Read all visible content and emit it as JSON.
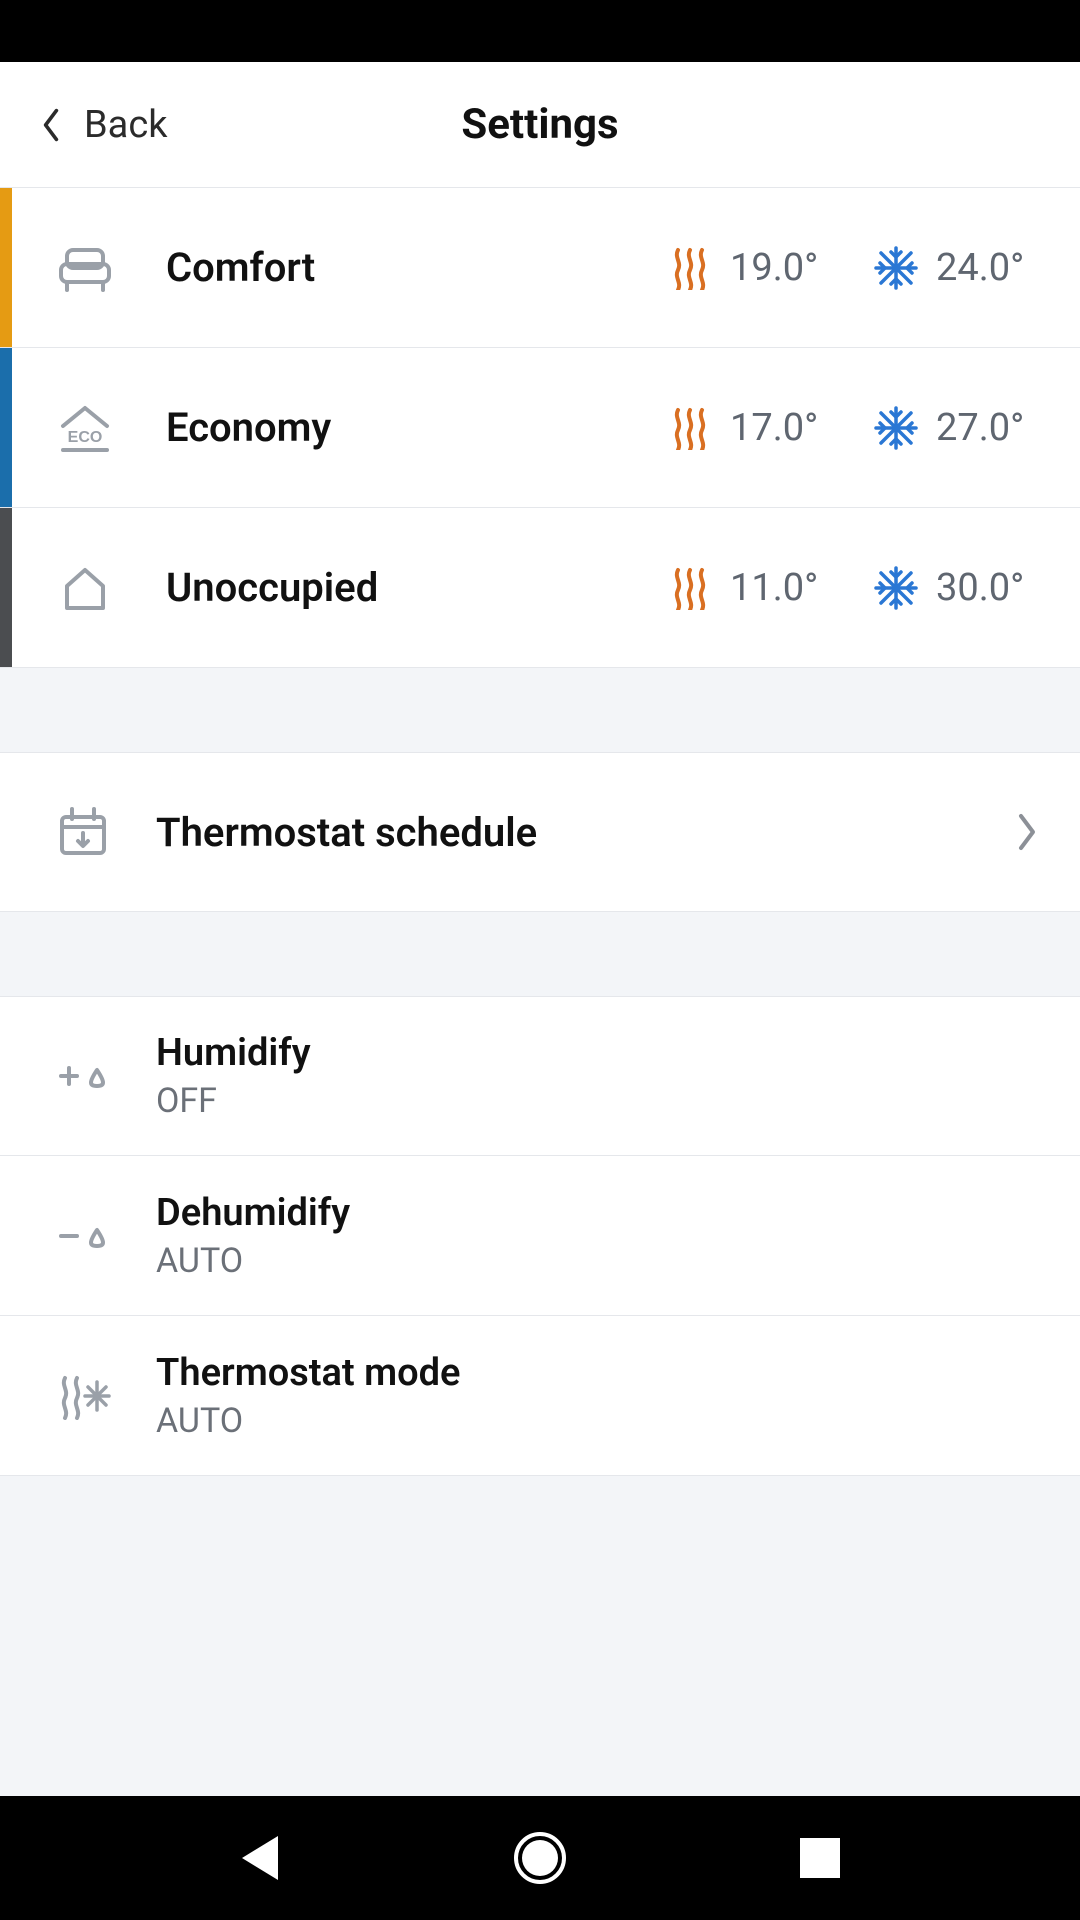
{
  "header": {
    "back_label": "Back",
    "title": "Settings"
  },
  "heat_color": "#d96f22",
  "cool_color": "#2a77d4",
  "modes": [
    {
      "name": "Comfort",
      "heat": "19.0°",
      "cool": "24.0°"
    },
    {
      "name": "Economy",
      "heat": "17.0°",
      "cool": "27.0°"
    },
    {
      "name": "Unoccupied",
      "heat": "11.0°",
      "cool": "30.0°"
    }
  ],
  "schedule_label": "Thermostat schedule",
  "settings": [
    {
      "title": "Humidify",
      "value": "OFF"
    },
    {
      "title": "Dehumidify",
      "value": "AUTO"
    },
    {
      "title": "Thermostat mode",
      "value": "AUTO"
    }
  ]
}
